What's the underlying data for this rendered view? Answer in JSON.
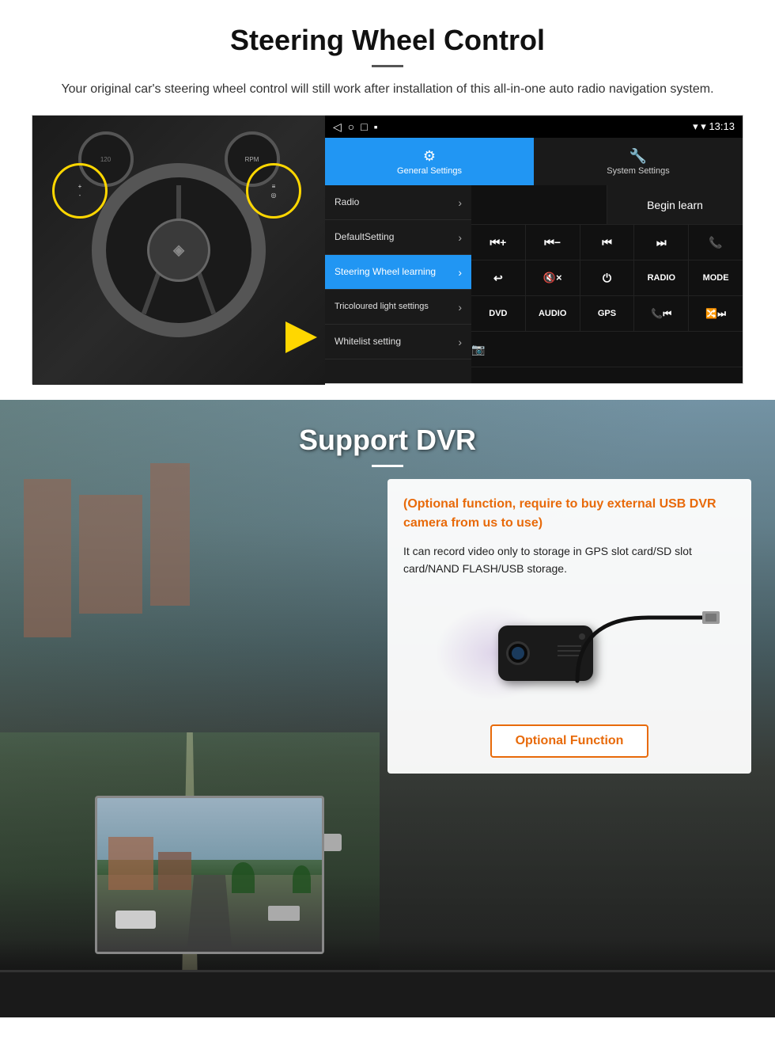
{
  "section1": {
    "title": "Steering Wheel Control",
    "description": "Your original car's steering wheel control will still work after installation of this all-in-one auto radio navigation system.",
    "android_ui": {
      "status_bar": {
        "back_icon": "◁",
        "home_icon": "○",
        "square_icon": "□",
        "menu_icon": "▪",
        "signal_icon": "▾",
        "wifi_icon": "▾",
        "time": "13:13"
      },
      "tabs": [
        {
          "label": "General Settings",
          "icon": "⚙",
          "active": true
        },
        {
          "label": "System Settings",
          "icon": "🔧",
          "active": false
        }
      ],
      "menu_items": [
        {
          "label": "Radio",
          "active": false
        },
        {
          "label": "DefaultSetting",
          "active": false
        },
        {
          "label": "Steering Wheel learning",
          "active": true
        },
        {
          "label": "Tricoloured light settings",
          "active": false
        },
        {
          "label": "Whitelist setting",
          "active": false
        }
      ],
      "begin_learn_label": "Begin learn",
      "control_buttons": [
        [
          "⏮+",
          "⏮-",
          "⏮",
          "⏭",
          "📞"
        ],
        [
          "↩",
          "🔇x",
          "⏻",
          "RADIO",
          "MODE"
        ],
        [
          "DVD",
          "AUDIO",
          "GPS",
          "📞⏮",
          "🔀⏭"
        ],
        [
          "📷"
        ]
      ]
    }
  },
  "section2": {
    "title": "Support DVR",
    "optional_text": "(Optional function, require to buy external USB DVR camera from us to use)",
    "description": "It can record video only to storage in GPS slot card/SD slot card/NAND FLASH/USB storage.",
    "button_label": "Optional Function"
  }
}
